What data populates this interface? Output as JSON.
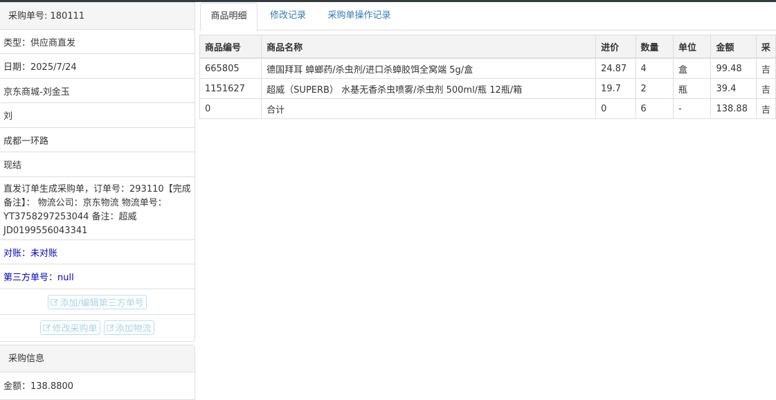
{
  "order": {
    "header": "采购单号: 180111",
    "type": "类型：供应商直发",
    "date": "日期：2025/7/24",
    "store": "京东商城-刘金玉",
    "person": "刘",
    "address": "成都一环路",
    "payment": "现结",
    "remark": "直发订单生成采购单，订单号：293110【完成备注】： 物流公司：京东物流 物流单号：YT3758297253044 备注：超威JD0199556043341",
    "reconcile": "对账：未对账",
    "third_party": "第三方单号：null",
    "btn_third_party": "添加/编辑第三方单号",
    "btn_edit": "修改采购单",
    "btn_logistics": "添加物流"
  },
  "purchase_info": {
    "header": "采购信息",
    "amount": "金额：138.8800"
  },
  "tabs": {
    "detail": "商品明细",
    "modify_log": "修改记录",
    "op_log": "采购单操作记录"
  },
  "table": {
    "headers": {
      "code": "商品编号",
      "name": "商品名称",
      "price": "进价",
      "qty": "数量",
      "unit": "单位",
      "amount": "金额",
      "extra": "采"
    },
    "rows": [
      {
        "code": "665805",
        "name": "德国拜耳 蟑螂药/杀虫剂/进口杀蟑胶饵全窝端 5g/盒",
        "price": "24.87",
        "qty": "4",
        "unit": "盒",
        "amount": "99.48",
        "extra": "吉"
      },
      {
        "code": "1151627",
        "name": "超威（SUPERB） 水基无香杀虫喷雾/杀虫剂 500ml/瓶 12瓶/箱",
        "price": "19.7",
        "qty": "2",
        "unit": "瓶",
        "amount": "39.4",
        "extra": "吉"
      },
      {
        "code": "0",
        "name": "合计",
        "price": "0",
        "qty": "6",
        "unit": "-",
        "amount": "138.88",
        "extra": "吉"
      }
    ]
  }
}
